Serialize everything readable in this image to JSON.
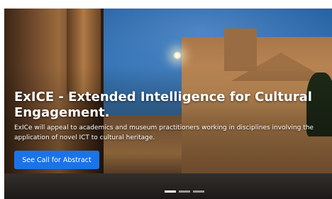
{
  "hero": {
    "headline": "ExICE - Extended Intelligence for Cultural Engagement.",
    "description": "ExICe will appeal to academics and museum practitioners working in disciplines involving the application of novel ICT to cultural heritage.",
    "cta_label": "See Call for Abstract",
    "background_image": "basilica-santo-stefano-twilight",
    "slides_total": 3,
    "active_slide": 1
  },
  "colors": {
    "accent": "#1a73e8",
    "headline_text": "#ffffff"
  }
}
